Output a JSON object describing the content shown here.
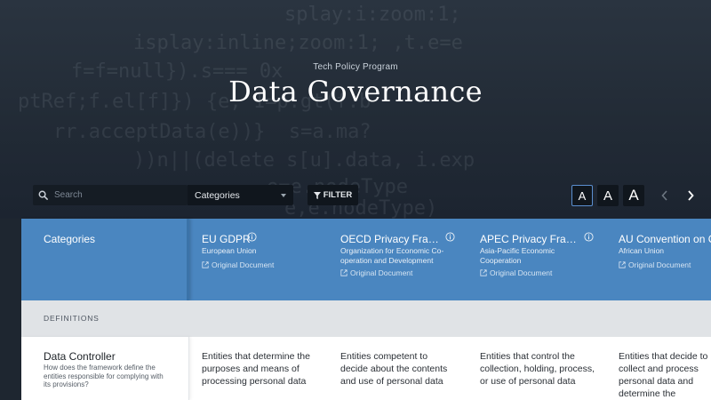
{
  "hero": {
    "eyebrow": "Tech Policy Program",
    "title": "Data Governance",
    "code_lines": [
      "splay:i:zoom:1;",
      "isplay:inline;zoom:1; ,t.e=e",
      "f=f=null}).s=== 0x",
      "ptRef;f.el[f]}) {e, 1=p.gt(f.b",
      "rr.acceptData(e))}  s=a.ma?",
      "))n||(delete s[u].data, i.exp",
      "e=e.nodeType",
      "e,e.nodeType)"
    ]
  },
  "toolbar": {
    "search_placeholder": "Search",
    "categories_label": "Categories",
    "filter_label": "FILTER",
    "font_small": "A",
    "font_medium": "A",
    "font_large": "A"
  },
  "table": {
    "category_header": "Categories",
    "columns": [
      {
        "title": "EU GDPR",
        "subtitle": "European Union",
        "link": "Original Document"
      },
      {
        "title": "OECD Privacy Framework",
        "subtitle": "Organization for Economic Co-operation and Development",
        "link": "Original Document"
      },
      {
        "title": "APEC Privacy Framework",
        "subtitle": "Asia-Pacific Economic Cooperation",
        "link": "Original Document"
      },
      {
        "title": "AU Convention on Cyber Security",
        "subtitle": "African Union",
        "link": "Original Document"
      }
    ],
    "section_label": "DEFINITIONS",
    "rows": [
      {
        "title": "Data Controller",
        "question": "How does the framework define the entities responsible for complying with its provisions?",
        "cells": [
          "Entities that determine the purposes and means of processing personal data",
          "Entities competent to decide about the contents and use of personal data",
          "Entities that control the collection, holding, process, or use of personal data",
          "Entities that decide to collect and process personal data and determine the purposes"
        ]
      }
    ]
  },
  "colors": {
    "hero_bg": "#222b36",
    "header_blue": "#4a86c0",
    "section_gray": "#e0e3e6",
    "accent_outline": "#5b8fd0"
  }
}
